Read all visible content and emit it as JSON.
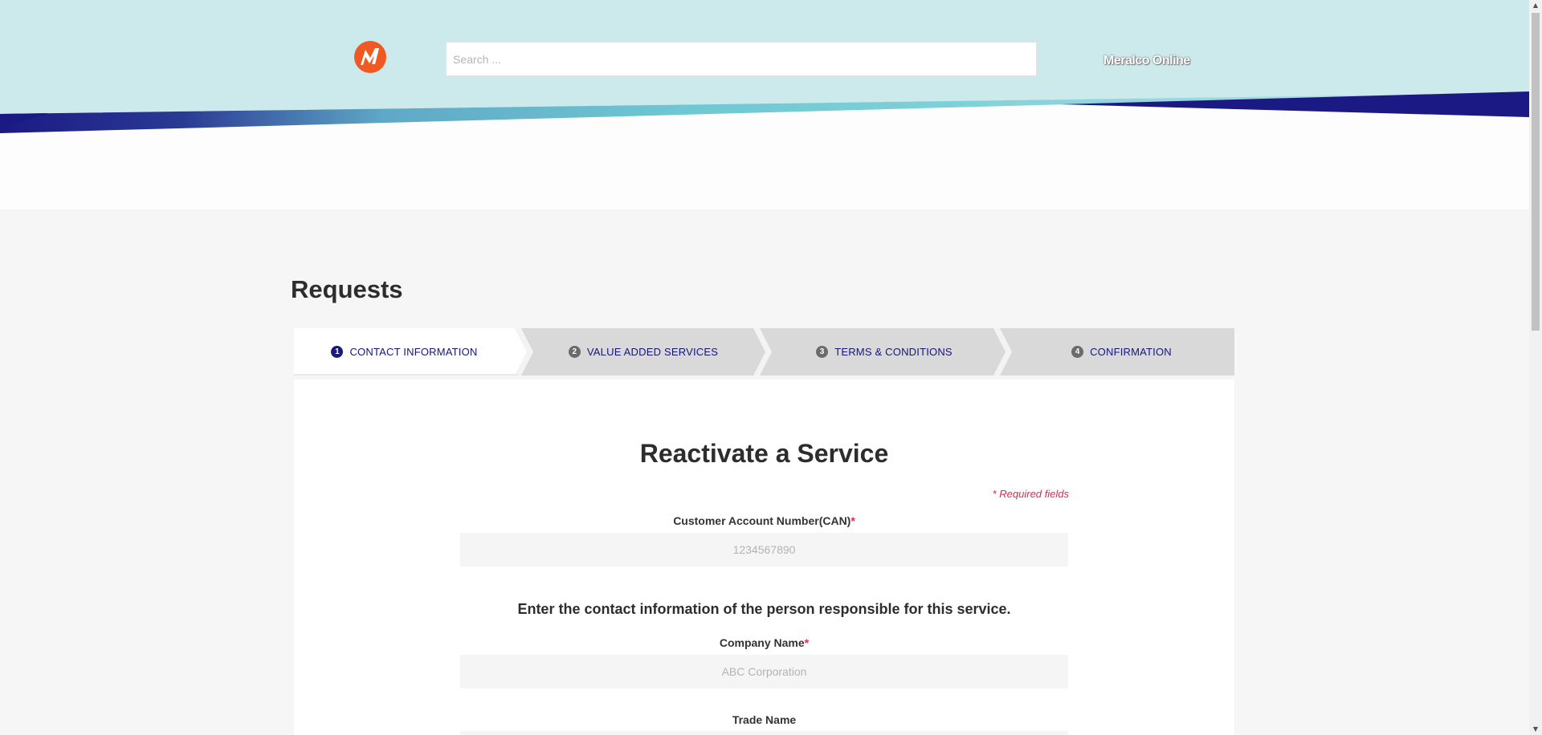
{
  "header": {
    "search": {
      "placeholder": "Search ..."
    },
    "brand_link": "Meralco Online",
    "colors": {
      "sky": "#cce9eb",
      "navy": "#1b1a85",
      "teal": "#6cc5d0",
      "logo": "#f05a22"
    }
  },
  "main": {
    "page_title": "Requests",
    "steps": [
      {
        "number": "1",
        "label": "CONTACT INFORMATION",
        "active": true
      },
      {
        "number": "2",
        "label": "VALUE ADDED SERVICES",
        "active": false
      },
      {
        "number": "3",
        "label": "TERMS & CONDITIONS",
        "active": false
      },
      {
        "number": "4",
        "label": "CONFIRMATION",
        "active": false
      }
    ],
    "form": {
      "title": "Reactivate a Service",
      "required_note": "* Required fields",
      "can": {
        "label": "Customer Account Number(CAN)",
        "required_mark": "*",
        "placeholder": "1234567890"
      },
      "instruction": "Enter the contact information of the person responsible for this service.",
      "company_name": {
        "label": "Company Name",
        "required_mark": "*",
        "placeholder": "ABC Corporation"
      },
      "trade_name": {
        "label": "Trade Name"
      }
    }
  }
}
